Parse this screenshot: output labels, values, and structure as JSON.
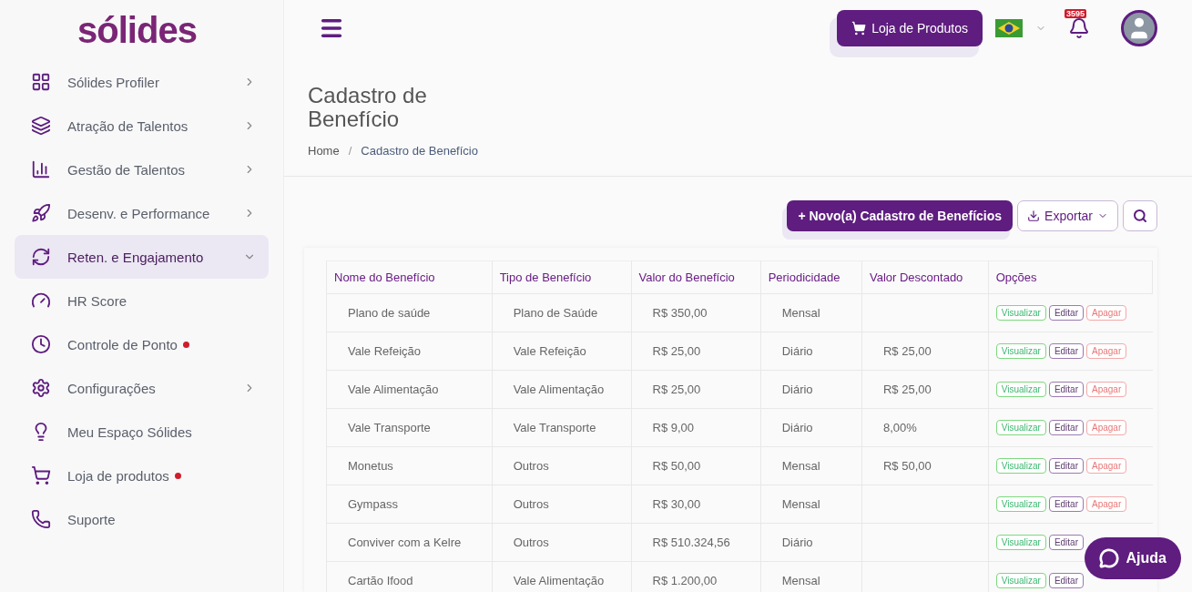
{
  "logo": "sólides",
  "sidebar": {
    "items": [
      {
        "label": "Sólides Profiler",
        "expandable": true,
        "expanded": false,
        "selected": false,
        "alert": false
      },
      {
        "label": "Atração de Talentos",
        "expandable": true,
        "expanded": false,
        "selected": false,
        "alert": false
      },
      {
        "label": "Gestão de Talentos",
        "expandable": true,
        "expanded": false,
        "selected": false,
        "alert": false
      },
      {
        "label": "Desenv. e Performance",
        "expandable": true,
        "expanded": false,
        "selected": false,
        "alert": false
      },
      {
        "label": "Reten. e Engajamento",
        "expandable": true,
        "expanded": true,
        "selected": true,
        "alert": false
      },
      {
        "label": "HR Score",
        "expandable": false,
        "expanded": false,
        "selected": false,
        "alert": false
      },
      {
        "label": "Controle de Ponto",
        "expandable": false,
        "expanded": false,
        "selected": false,
        "alert": true
      },
      {
        "label": "Configurações",
        "expandable": true,
        "expanded": false,
        "selected": false,
        "alert": false
      },
      {
        "label": "Meu Espaço Sólides",
        "expandable": false,
        "expanded": false,
        "selected": false,
        "alert": false
      },
      {
        "label": "Loja de produtos",
        "expandable": false,
        "expanded": false,
        "selected": false,
        "alert": true
      },
      {
        "label": "Suporte",
        "expandable": false,
        "expanded": false,
        "selected": false,
        "alert": false
      }
    ]
  },
  "header": {
    "store_button": "Loja de Produtos",
    "notifications": "3595"
  },
  "page": {
    "title": "Cadastro de Benefício",
    "breadcrumb": [
      "Home",
      "Cadastro de Benefício"
    ],
    "breadcrumb_separator": "/"
  },
  "toolbar": {
    "new_button": "+ Novo(a) Cadastro de Benefícios",
    "export_button": "Exportar"
  },
  "table": {
    "columns": [
      "Nome do Benefício",
      "Tipo de Benefício",
      "Valor do Benefício",
      "Periodicidade",
      "Valor Descontado",
      "Opções"
    ],
    "rows": [
      {
        "cells": [
          "Plano de saúde",
          "Plano de Saúde",
          "R$ 350,00",
          "Mensal",
          ""
        ],
        "actions": [
          {
            "label": "Visualizar",
            "kind": "view"
          },
          {
            "label": "Editar",
            "kind": "edit"
          },
          {
            "label": "Apagar",
            "kind": "delete"
          }
        ]
      },
      {
        "cells": [
          "Vale Refeição",
          "Vale Refeição",
          "R$ 25,00",
          "Diário",
          "R$ 25,00"
        ],
        "actions": [
          {
            "label": "Visualizar",
            "kind": "view"
          },
          {
            "label": "Editar",
            "kind": "edit"
          },
          {
            "label": "Apagar",
            "kind": "delete"
          }
        ]
      },
      {
        "cells": [
          "Vale Alimentação",
          "Vale Alimentação",
          "R$ 25,00",
          "Diário",
          "R$ 25,00"
        ],
        "actions": [
          {
            "label": "Visualizar",
            "kind": "view"
          },
          {
            "label": "Editar",
            "kind": "edit"
          },
          {
            "label": "Apagar",
            "kind": "delete"
          }
        ]
      },
      {
        "cells": [
          "Vale Transporte",
          "Vale Transporte",
          "R$ 9,00",
          "Diário",
          "8,00%"
        ],
        "actions": [
          {
            "label": "Visualizar",
            "kind": "view"
          },
          {
            "label": "Editar",
            "kind": "edit"
          },
          {
            "label": "Apagar",
            "kind": "delete"
          }
        ]
      },
      {
        "cells": [
          "Monetus",
          "Outros",
          "R$ 50,00",
          "Mensal",
          "R$ 50,00"
        ],
        "actions": [
          {
            "label": "Visualizar",
            "kind": "view"
          },
          {
            "label": "Editar",
            "kind": "edit"
          },
          {
            "label": "Apagar",
            "kind": "delete"
          }
        ]
      },
      {
        "cells": [
          "Gympass",
          "Outros",
          "R$ 30,00",
          "Mensal",
          ""
        ],
        "actions": [
          {
            "label": "Visualizar",
            "kind": "view"
          },
          {
            "label": "Editar",
            "kind": "edit"
          },
          {
            "label": "Apagar",
            "kind": "delete"
          }
        ]
      },
      {
        "cells": [
          "Conviver com a Kelre",
          "Outros",
          "R$ 510.324,56",
          "Diário",
          ""
        ],
        "actions": [
          {
            "label": "Visualizar",
            "kind": "view"
          },
          {
            "label": "Editar",
            "kind": "edit"
          }
        ]
      },
      {
        "cells": [
          "Cartão Ifood",
          "Vale Alimentação",
          "R$ 1.200,00",
          "Mensal",
          ""
        ],
        "actions": [
          {
            "label": "Visualizar",
            "kind": "view"
          },
          {
            "label": "Editar",
            "kind": "edit"
          }
        ]
      }
    ]
  },
  "help_button": "Ajuda"
}
